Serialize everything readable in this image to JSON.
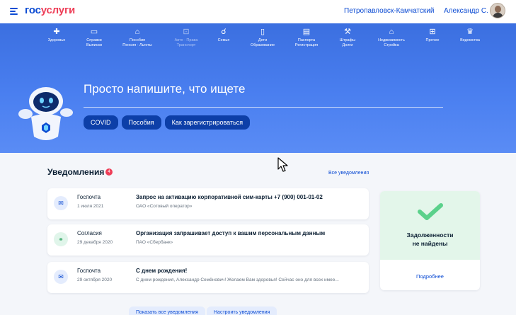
{
  "header": {
    "logo_part1": "гос",
    "logo_part2": "услуги",
    "city": "Петропавловск-Камчатский",
    "user_name": "Александр С."
  },
  "categories": [
    {
      "icon": "plus-cross-icon",
      "line1": "Здоровье",
      "line2": ""
    },
    {
      "icon": "folder-icon",
      "line1": "Справки",
      "line2": "Выписки"
    },
    {
      "icon": "bag-icon",
      "line1": "Пособия",
      "line2": "Пенсия · Льготы"
    },
    {
      "icon": "car-icon",
      "line1": "Авто · Права",
      "line2": "Транспорт"
    },
    {
      "icon": "stroller-icon",
      "line1": "Семья",
      "line2": ""
    },
    {
      "icon": "book-icon",
      "line1": "Дети",
      "line2": "Образование"
    },
    {
      "icon": "passport-icon",
      "line1": "Паспорта",
      "line2": "Регистрация"
    },
    {
      "icon": "gavel-icon",
      "line1": "Штрафы",
      "line2": "Долги"
    },
    {
      "icon": "house-icon",
      "line1": "Недвижимость",
      "line2": "Стройка"
    },
    {
      "icon": "grid-icon",
      "line1": "Прочее",
      "line2": ""
    },
    {
      "icon": "emblem-icon",
      "line1": "Ведомства",
      "line2": ""
    }
  ],
  "hero": {
    "title": "Просто напишите, что ищете",
    "chips": [
      "COVID",
      "Пособия",
      "Как зарегистрироваться"
    ]
  },
  "notifications": {
    "title": "Уведомления",
    "count": "4",
    "all_link": "Все уведомления",
    "items": [
      {
        "icon": "mail-icon",
        "from": "Госпочта",
        "date": "1 июля 2021",
        "subject": "Запрос на активацию корпоративной сим-карты +7 (900) 001-01-02",
        "org": "ОАО «Сотовый оператор»"
      },
      {
        "icon": "consent-icon",
        "from": "Согласия",
        "date": "29 декабря 2020",
        "subject": "Организация запрашивает доступ к вашим персональным данным",
        "org": "ПАО «Сбербанк»"
      },
      {
        "icon": "mail-icon",
        "from": "Госпочта",
        "date": "29 октября 2020",
        "subject": "С днем рождения!",
        "org": "С днем рождения, Александр Семёнович! Желаем Вам здоровья! Сейчас оно для всех имее..."
      }
    ],
    "show_all_button": "Показать все уведомления",
    "settings_button": "Настроить уведомления"
  },
  "debt": {
    "line1": "Задолженности",
    "line2": "не найдены",
    "more_link": "Подробнее"
  },
  "colors": {
    "brand_blue": "#0d4cd3",
    "brand_red": "#ee3f58",
    "hero_blue": "#4a7ff0",
    "success_green": "#5bd18b"
  }
}
